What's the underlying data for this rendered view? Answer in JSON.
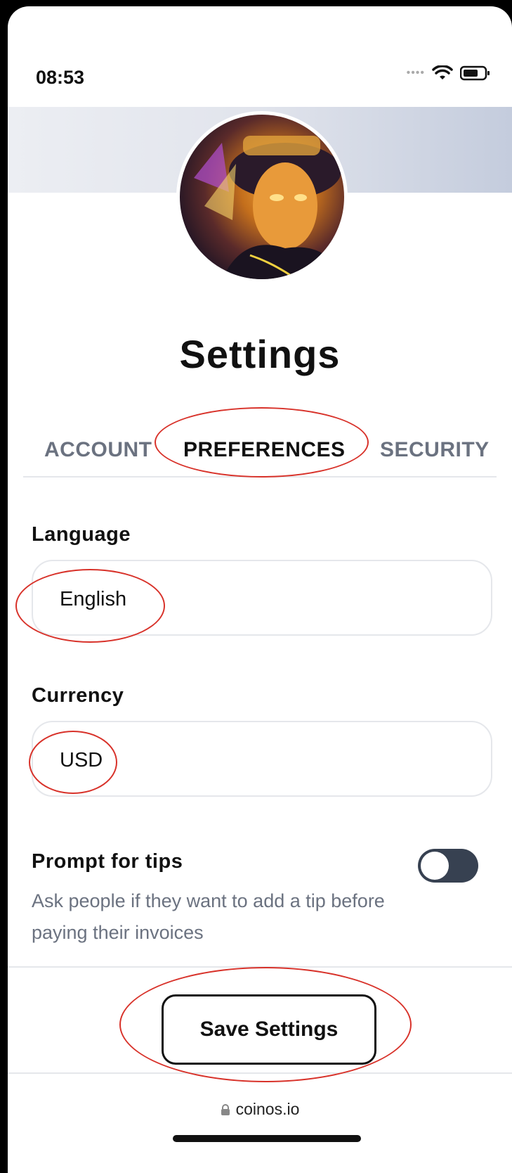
{
  "status_bar": {
    "time": "08:53"
  },
  "profile": {
    "page_title": "Settings"
  },
  "tabs": [
    {
      "label": "ACCOUNT",
      "active": false
    },
    {
      "label": "PREFERENCES",
      "active": true
    },
    {
      "label": "SECURITY",
      "active": false
    }
  ],
  "preferences": {
    "language_label": "Language",
    "language_value": "English",
    "currency_label": "Currency",
    "currency_value": "USD",
    "tips_label": "Prompt for tips",
    "tips_description": "Ask people if they want to add a tip before paying their invoices",
    "tips_enabled": false
  },
  "actions": {
    "save_label": "Save Settings"
  },
  "browser": {
    "url": "coinos.io"
  },
  "colors": {
    "annotation": "#d8322a",
    "toggle_off": "#374151"
  }
}
